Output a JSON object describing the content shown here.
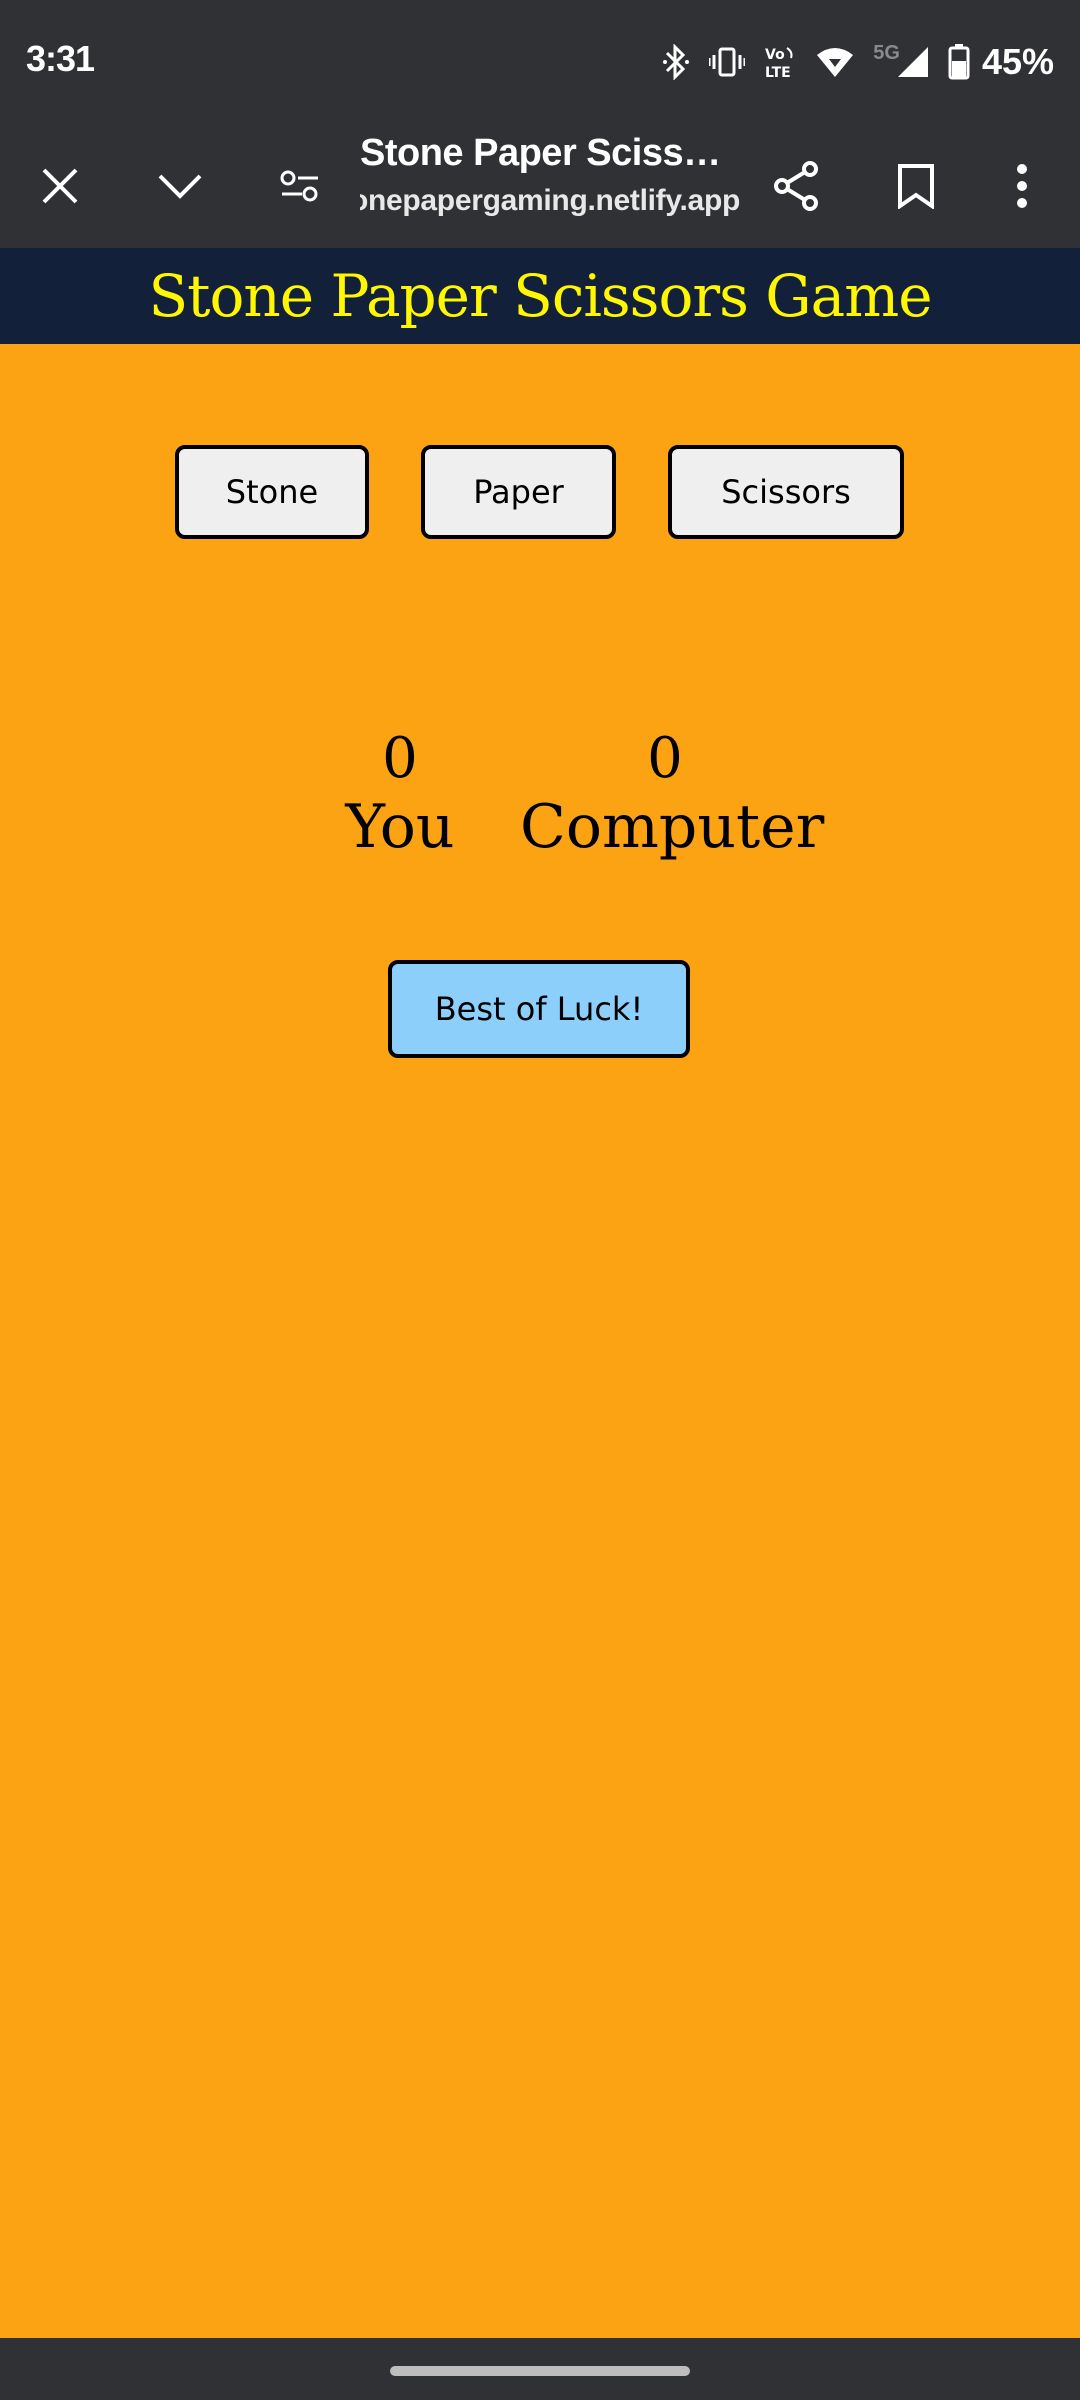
{
  "status_bar": {
    "time": "3:31",
    "battery": "45%",
    "network": "5G",
    "icons": [
      "bluetooth-icon",
      "vibrate-icon",
      "volte-icon",
      "wifi-icon",
      "signal-icon",
      "battery-icon"
    ]
  },
  "browser": {
    "page_title": "Stone Paper Sciss…",
    "url": "stonepapergaming.netlify.app",
    "icons": [
      "close-icon",
      "chevron-down-icon",
      "site-settings-icon",
      "share-icon",
      "bookmark-icon",
      "more-vert-icon"
    ]
  },
  "page": {
    "title": "Stone Paper Scissors Game",
    "choices": {
      "stone": "Stone",
      "paper": "Paper",
      "scissors": "Scissors"
    },
    "score": {
      "you_value": "0",
      "you_label": "You",
      "computer_value": "0",
      "computer_label": "Computer"
    },
    "message": "Best of Luck!"
  },
  "colors": {
    "page_bg": "#fba313",
    "header_bg": "#12203a",
    "title_color": "#fff700",
    "choice_bg": "#efefef",
    "message_bg": "#8ccffb",
    "chrome_bg": "#303134"
  }
}
